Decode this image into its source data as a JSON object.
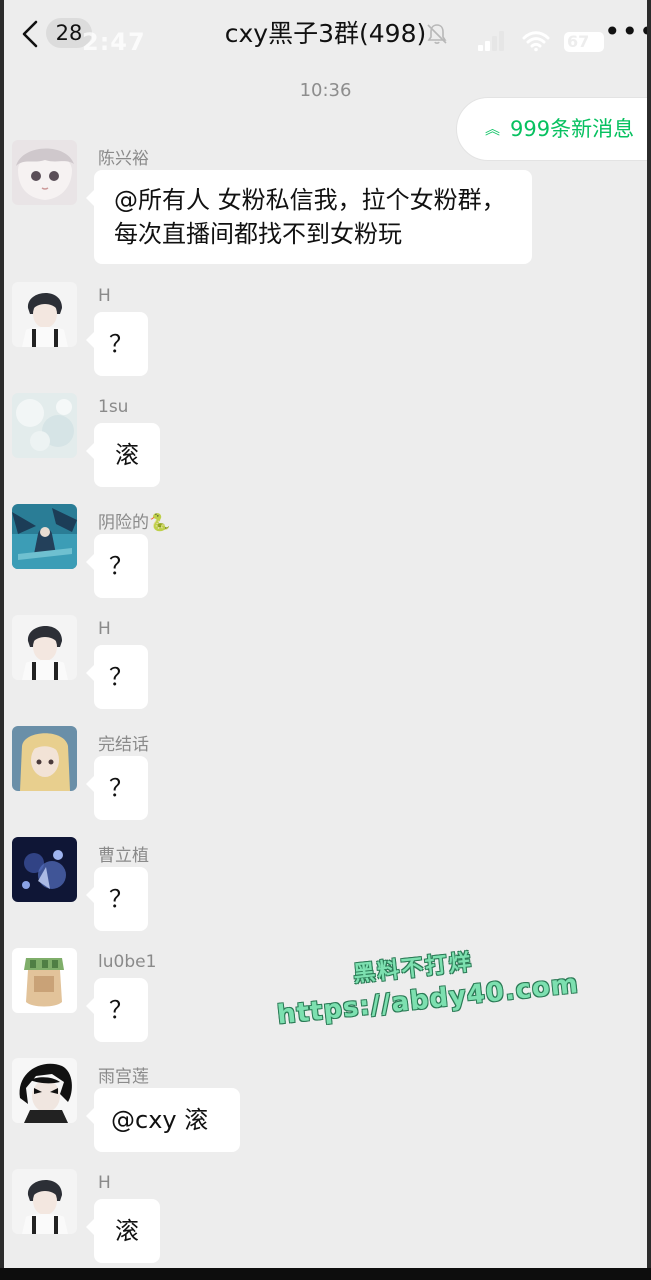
{
  "status_bar": {
    "time": "2:47",
    "battery": "67"
  },
  "header": {
    "back_badge": "28",
    "title": "cxy黑子3群(498)"
  },
  "time_divider": "10:36",
  "new_messages_pill": "999条新消息",
  "messages": [
    {
      "sender": "陈兴裕",
      "text": "@所有人  女粉私信我，拉个女粉群，每次直播间都找不到女粉玩"
    },
    {
      "sender": "H",
      "text": "？"
    },
    {
      "sender": "1su",
      "text": "滚"
    },
    {
      "sender": "阴险的🐍",
      "text": "？"
    },
    {
      "sender": "H",
      "text": "？"
    },
    {
      "sender": "完结话",
      "text": "？"
    },
    {
      "sender": "曹立植",
      "text": "？"
    },
    {
      "sender": "lu0be1",
      "text": "？"
    },
    {
      "sender": "雨宫莲",
      "text": "@cxy  滚"
    },
    {
      "sender": "H",
      "text": "滚"
    }
  ],
  "watermark": {
    "line1": "黑料不打烊",
    "line2": "https://abdy40.com"
  },
  "colors": {
    "accent_green": "#07c160",
    "chat_background": "#ededed",
    "bubble": "#ffffff"
  },
  "icons": [
    "back-arrow-icon",
    "mute-bell-icon",
    "signal-icon",
    "wifi-icon",
    "battery-icon",
    "more-icon",
    "double-chevron-up-icon"
  ]
}
